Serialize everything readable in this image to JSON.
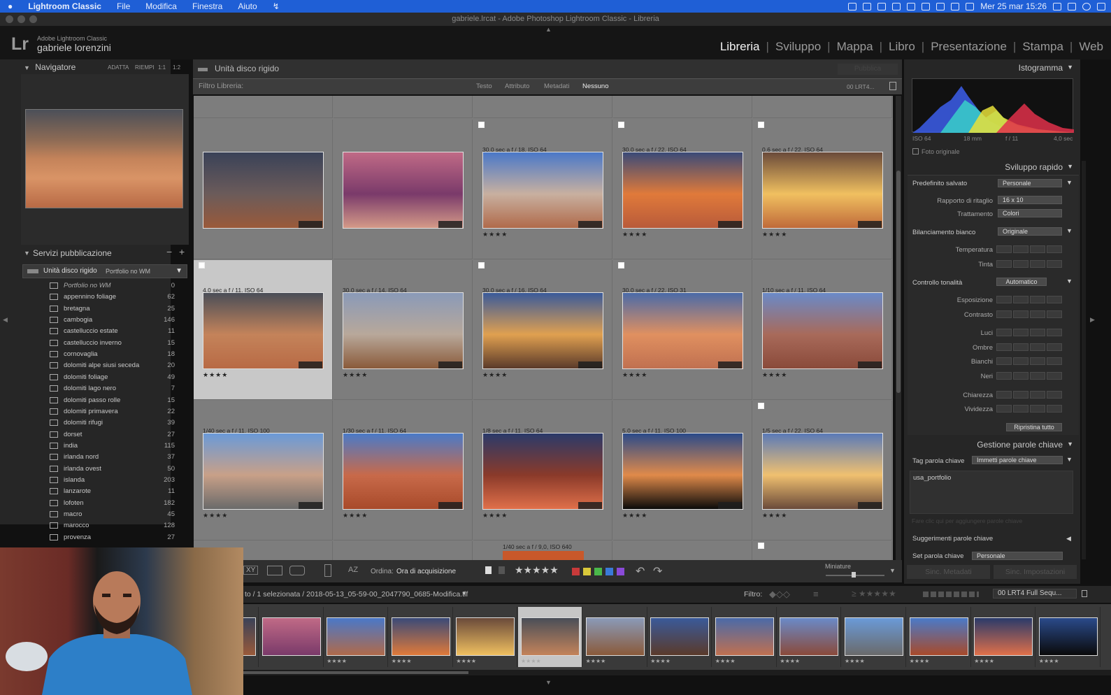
{
  "menubar": {
    "app": "Lightroom Classic",
    "items": [
      "File",
      "Modifica",
      "Finestra",
      "Aiuto"
    ],
    "clock": "Mer 25 mar  15:26"
  },
  "window_title": "gabriele.lrcat - Adobe Photoshop Lightroom Classic - Libreria",
  "identity": {
    "logo": "Lr",
    "product": "Adobe Lightroom Classic",
    "user": "gabriele lorenzini"
  },
  "modules": [
    "Libreria",
    "Sviluppo",
    "Mappa",
    "Libro",
    "Presentazione",
    "Stampa",
    "Web"
  ],
  "active_module": "Libreria",
  "navigator": {
    "title": "Navigatore",
    "options": [
      "ADATTA",
      "RIEMPI",
      "1:1",
      "1:2"
    ]
  },
  "publish": {
    "title": "Servizi pubblicazione",
    "service": "Unità disco rigido",
    "service_sub": "Portfolio no WM",
    "collections": [
      {
        "name": "Portfolio no WM",
        "count": "0"
      },
      {
        "name": "appennino foliage",
        "count": "62"
      },
      {
        "name": "bretagna",
        "count": "25"
      },
      {
        "name": "cambogia",
        "count": "146"
      },
      {
        "name": "castelluccio estate",
        "count": "11"
      },
      {
        "name": "castelluccio inverno",
        "count": "15"
      },
      {
        "name": "cornovaglia",
        "count": "18"
      },
      {
        "name": "dolomiti alpe siusi seceda",
        "count": "20"
      },
      {
        "name": "dolomiti foliage",
        "count": "49"
      },
      {
        "name": "dolomiti lago nero",
        "count": "7"
      },
      {
        "name": "dolomiti passo rolle",
        "count": "15"
      },
      {
        "name": "dolomiti primavera",
        "count": "22"
      },
      {
        "name": "dolomiti rifugi",
        "count": "39"
      },
      {
        "name": "dorset",
        "count": "27"
      },
      {
        "name": "india",
        "count": "115"
      },
      {
        "name": "irlanda nord",
        "count": "37"
      },
      {
        "name": "irlanda ovest",
        "count": "50"
      },
      {
        "name": "islanda",
        "count": "203"
      },
      {
        "name": "lanzarote",
        "count": "11"
      },
      {
        "name": "lofoten",
        "count": "182"
      },
      {
        "name": "macro",
        "count": "45"
      },
      {
        "name": "marocco",
        "count": "128"
      },
      {
        "name": "provenza",
        "count": "27"
      }
    ]
  },
  "center": {
    "source": "Unità disco rigido",
    "publish_button": "Pubblica",
    "filter_label": "Filtro Libreria:",
    "filter_tabs": [
      "Testo",
      "Attributo",
      "Metadati",
      "Nessuno"
    ],
    "filter_preset": "00 LRT4..."
  },
  "grid_rows": [
    [
      {
        "info": "",
        "stars": "",
        "flag": false,
        "colors": [
          "#3a4258",
          "#6b5b5a",
          "#9a5a3a"
        ]
      },
      {
        "info": "",
        "stars": "",
        "flag": false,
        "colors": [
          "#c06a86",
          "#7a3a6a",
          "#d49a88"
        ]
      },
      {
        "info": "30,0 sec a f / 18, ISO 64",
        "stars": "★★★★",
        "flag": true,
        "colors": [
          "#4a78c8",
          "#c8b0a0",
          "#b06a4a"
        ]
      },
      {
        "info": "30,0 sec a f / 22, ISO 64",
        "stars": "★★★★",
        "flag": true,
        "colors": [
          "#3a4a78",
          "#e07a3a",
          "#b85a3a"
        ]
      },
      {
        "info": "0,6 sec a f / 22, ISO 64",
        "stars": "★★★★",
        "flag": true,
        "colors": [
          "#6a4a3a",
          "#f0c060",
          "#c06a3a"
        ]
      }
    ],
    [
      {
        "info": "4,0 sec a f / 11, ISO 64",
        "stars": "★★★★",
        "flag": true,
        "selected": true,
        "colors": [
          "#4a4e58",
          "#c4835a",
          "#b86a45"
        ]
      },
      {
        "info": "30,0 sec a f / 14, ISO 64",
        "stars": "★★★★",
        "flag": false,
        "colors": [
          "#8a9ab8",
          "#b8a89a",
          "#8a5a3a"
        ]
      },
      {
        "info": "30,0 sec a f / 16, ISO 64",
        "stars": "★★★★",
        "flag": true,
        "colors": [
          "#3a5a9a",
          "#e0a050",
          "#5a3a2a"
        ]
      },
      {
        "info": "30,0 sec a f / 22, ISO 31",
        "stars": "★★★★",
        "flag": true,
        "colors": [
          "#4a6aa8",
          "#e09060",
          "#c07050"
        ]
      },
      {
        "info": "1/10 sec a f / 11, ISO 64",
        "stars": "★★★★",
        "flag": false,
        "colors": [
          "#6a8ac8",
          "#a86a5a",
          "#8a4a3a"
        ]
      }
    ],
    [
      {
        "info": "1/40 sec a f / 11, ISO 100",
        "stars": "★★★★",
        "flag": false,
        "colors": [
          "#6a9ad8",
          "#c8a088",
          "#6a6a6a"
        ]
      },
      {
        "info": "1/30 sec a f / 11, ISO 64",
        "stars": "★★★★",
        "flag": false,
        "colors": [
          "#4a7ac8",
          "#c86a4a",
          "#a84a2a"
        ]
      },
      {
        "info": "1/8 sec a f / 11, ISO 64",
        "stars": "★★★★",
        "flag": false,
        "colors": [
          "#2a3a6a",
          "#8a3a2a",
          "#e0704a"
        ]
      },
      {
        "info": "5,0 sec a f / 11, ISO 100",
        "stars": "★★★★",
        "flag": false,
        "colors": [
          "#2a4a8a",
          "#e08a4a",
          "#0a0a0a"
        ]
      },
      {
        "info": "1/5 sec a f / 22, ISO 64",
        "stars": "★★★★",
        "flag": true,
        "colors": [
          "#5a7ab8",
          "#f0c070",
          "#6a4a3a"
        ]
      }
    ]
  ],
  "partial_info": "1/40 sec a f / 9,0, ISO 640",
  "toolbar": {
    "sort_label": "Ordina:",
    "sort_value": "Ora di acquisizione",
    "thumbs_label": "Miniature",
    "stars": "★★★★★",
    "label_colors": [
      "#c83a3a",
      "#d8c83a",
      "#4ab84a",
      "#3a7ad8",
      "#8a4ad8"
    ]
  },
  "right": {
    "histogram_title": "Istogramma",
    "histo_meta": [
      "ISO 64",
      "18 mm",
      "f / 11",
      "4,0 sec"
    ],
    "original_photo": "Foto originale",
    "quick_dev_title": "Sviluppo rapido",
    "saved_preset_label": "Predefinito salvato",
    "saved_preset_value": "Personale",
    "crop_label": "Rapporto di ritaglio",
    "crop_value": "16 x 10",
    "treatment_label": "Trattamento",
    "treatment_value": "Colori",
    "wb_label": "Bilanciamento bianco",
    "wb_value": "Originale",
    "temp_label": "Temperatura",
    "tint_label": "Tinta",
    "tone_label": "Controllo tonalità",
    "tone_value": "Automatico",
    "tone_rows": [
      "Esposizione",
      "Contrasto",
      "Luci",
      "Ombre",
      "Bianchi",
      "Neri",
      "Chiarezza",
      "Vividezza"
    ],
    "reset_all": "Ripristina tutto",
    "keywords_title": "Gestione parole chiave",
    "keyword_tag_label": "Tag parola chiave",
    "keyword_tag_value": "Immetti parole chiave",
    "keyword_text": "usa_portfolio",
    "keyword_hint": "Fare clic qui per aggiungere parole chiave",
    "suggestions": "Suggerimenti parole chiave",
    "keyword_set_label": "Set parola chiave",
    "keyword_set_value": "Personale",
    "sync_meta": "Sinc. Metadati",
    "sync_settings": "Sinc. Impostazioni"
  },
  "filmstrip": {
    "info_prefix": "to / 1 selezionata / 2018-05-13_05-59-00_2047790_0685-Modifica.tif",
    "filter_label": "Filtro:",
    "filter_preset": "00 LRT4 Full Sequ...",
    "thumbs": [
      {
        "colors": [
          "#3a4258",
          "#9a5a3a"
        ],
        "selected": false
      },
      {
        "colors": [
          "#c06a86",
          "#7a3a6a"
        ],
        "selected": false
      },
      {
        "colors": [
          "#4a78c8",
          "#b06a4a"
        ],
        "selected": false
      },
      {
        "colors": [
          "#3a4a78",
          "#e07a3a"
        ],
        "selected": false
      },
      {
        "colors": [
          "#6a4a3a",
          "#f0c060"
        ],
        "selected": false
      },
      {
        "colors": [
          "#4a4e58",
          "#c4835a"
        ],
        "selected": true
      },
      {
        "colors": [
          "#8a9ab8",
          "#8a5a3a"
        ],
        "selected": false
      },
      {
        "colors": [
          "#3a5a9a",
          "#5a3a2a"
        ],
        "selected": false
      },
      {
        "colors": [
          "#4a6aa8",
          "#c07050"
        ],
        "selected": false
      },
      {
        "colors": [
          "#6a8ac8",
          "#8a4a3a"
        ],
        "selected": false
      },
      {
        "colors": [
          "#6a9ad8",
          "#6a6a6a"
        ],
        "selected": false
      },
      {
        "colors": [
          "#4a7ac8",
          "#a84a2a"
        ],
        "selected": false
      },
      {
        "colors": [
          "#2a3a6a",
          "#e0704a"
        ],
        "selected": false
      },
      {
        "colors": [
          "#2a4a8a",
          "#0a0a0a"
        ],
        "selected": false
      }
    ],
    "thumb_stars": "★★★★"
  }
}
